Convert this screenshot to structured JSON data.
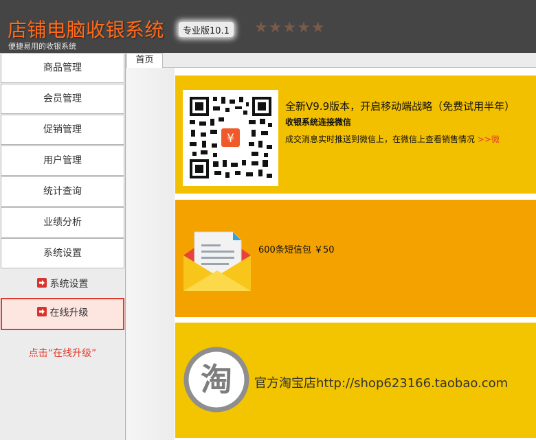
{
  "header": {
    "title": "店铺电脑收银系统",
    "subtitle": "便捷易用的收银系统",
    "edition": "专业版10.1",
    "stars": "★★★★★"
  },
  "sidebar": {
    "items": [
      {
        "label": "商品管理"
      },
      {
        "label": "会员管理"
      },
      {
        "label": "促销管理"
      },
      {
        "label": "用户管理"
      },
      {
        "label": "统计查询"
      },
      {
        "label": "业绩分析"
      },
      {
        "label": "系统设置"
      }
    ],
    "sub_items": [
      {
        "label": "系统设置",
        "active": false
      },
      {
        "label": "在线升级",
        "active": true
      }
    ],
    "hint": "点击“在线升级”"
  },
  "tabs": [
    {
      "label": "首页",
      "active": true
    }
  ],
  "panels": {
    "wechat": {
      "headline": "全新V9.9版本，开启移动端战略（免费试用半年）",
      "subheadline": "收银系统连接微信",
      "description": "成交消息实时推送到微信上，在微信上查看销售情况 ",
      "link_text": ">>微"
    },
    "sms": {
      "text": "600条短信包 ￥50"
    },
    "taobao": {
      "text": "官方淘宝店http://shop623166.taobao.com"
    }
  },
  "colors": {
    "header_bg": "#454545",
    "title": "#ff6a1a",
    "panel_yellow": "#f3c000",
    "panel_orange": "#f3a200",
    "accent_red": "#e23a2c"
  },
  "icons": [
    "star-icon",
    "arrow-right-icon",
    "qr-code-icon",
    "envelope-icon",
    "taobao-logo-icon"
  ]
}
